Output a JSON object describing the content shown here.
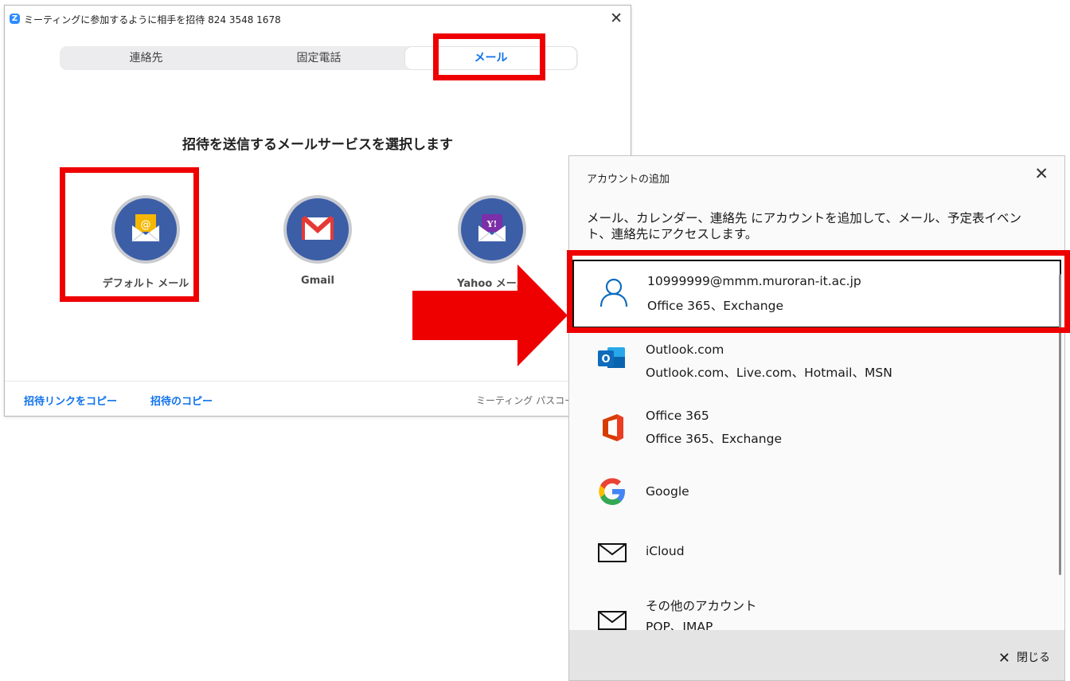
{
  "zoom_window": {
    "title": "ミーティングに参加するように相手を招待 824 3548 1678",
    "tabs": [
      {
        "label": "連絡先"
      },
      {
        "label": "固定電話"
      },
      {
        "label": "メール",
        "selected": true
      }
    ],
    "heading": "招待を送信するメールサービスを選択します",
    "services": [
      {
        "label": "デフォルト メール",
        "icon": "default-mail-icon"
      },
      {
        "label": "Gmail",
        "icon": "gmail-icon"
      },
      {
        "label": "Yahoo メール",
        "icon": "yahoo-mail-icon"
      }
    ],
    "footer": {
      "copy_invite_link": "招待リンクをコピー",
      "copy_invite": "招待のコピー",
      "meeting_passcode": "ミーティング パスコー"
    }
  },
  "account_dialog": {
    "title": "アカウントの追加",
    "description": "メール、カレンダー、連絡先 にアカウントを追加して、メール、予定表イベント、連絡先にアクセスします。",
    "accounts": [
      {
        "name": "10999999@mmm.muroran-it.ac.jp",
        "sub": "Office 365、Exchange",
        "icon": "person-icon"
      },
      {
        "name": "Outlook.com",
        "sub": "Outlook.com、Live.com、Hotmail、MSN",
        "icon": "outlook-icon"
      },
      {
        "name": "Office 365",
        "sub": "Office 365、Exchange",
        "icon": "office-icon"
      },
      {
        "name": "Google",
        "sub": "",
        "icon": "google-icon"
      },
      {
        "name": "iCloud",
        "sub": "",
        "icon": "envelope-icon"
      },
      {
        "name": "その他のアカウント",
        "sub": "POP、IMAP",
        "icon": "envelope-icon"
      }
    ],
    "close_label": "閉じる"
  },
  "colors": {
    "highlight": "#ef0000",
    "zoom_blue": "#0e72ed",
    "service_circle": "#3c5ea7",
    "dialog_footer": "#e4e4e4"
  }
}
